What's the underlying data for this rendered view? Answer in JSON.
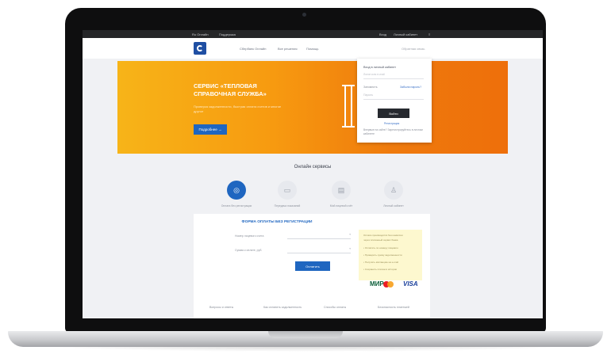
{
  "topbar": {
    "left": [
      "Ru Онлайн",
      "Поддержка"
    ],
    "right": [
      "Вход",
      "Личный кабинет",
      "≡"
    ]
  },
  "header": {
    "nav": [
      "Сбербанк Онлайн",
      "Все решения",
      "Помощь"
    ],
    "right": "Обратная связь"
  },
  "hero": {
    "title": "СЕРВИС «ТЕПЛОВАЯ СПРАВОЧНАЯ СЛУЖБА»",
    "subtitle": "Проверка задолженности, быстрая оплата счетов и многое другое",
    "button": "Подробнее →"
  },
  "login": {
    "title": "Вход в личный кабинет",
    "login_placeholder": "Логин или e-mail",
    "remember": "Запомнить",
    "forgot": "Забыли пароль?",
    "password_placeholder": "Пароль",
    "submit": "Войти",
    "register": "Регистрация",
    "note": "Впервые на сайте? Зарегистрируйтесь в личном кабинете"
  },
  "services": {
    "title": "Онлайн сервисы",
    "items": [
      {
        "label": "Оплата без регистрации",
        "icon": "camera-icon",
        "active": true
      },
      {
        "label": "Передача показаний",
        "icon": "meter-icon",
        "active": false
      },
      {
        "label": "Мой лицевой счёт",
        "icon": "receipt-icon",
        "active": false
      },
      {
        "label": "Личный кабинет",
        "icon": "user-icon",
        "active": false
      }
    ]
  },
  "form": {
    "title": "ФОРМА ОПЛАТЫ БЕЗ РЕГИСТРАЦИИ",
    "field1_label": "Номер лицевого счета",
    "field2_label": "Сумма к оплате, руб.",
    "button": "Оплатить",
    "note": [
      "Оплата производится без комиссии",
      "через платежный сервис банка",
      "• Оплатить по номеру лицевого",
      "• Проверить сумму задолженности",
      "• Получить квитанцию на e-mail",
      "• Сохранить платеж в истории"
    ],
    "cards": {
      "mastercard": "MasterCard",
      "mir": "МИР",
      "visa": "VISA"
    }
  },
  "footer": {
    "links": [
      "Вопросы и ответы",
      "Как оплатить задолженность",
      "Способы оплаты",
      "Безопасность платежей"
    ]
  },
  "colors": {
    "accent": "#1f66c0",
    "hero": "#f79a10"
  }
}
